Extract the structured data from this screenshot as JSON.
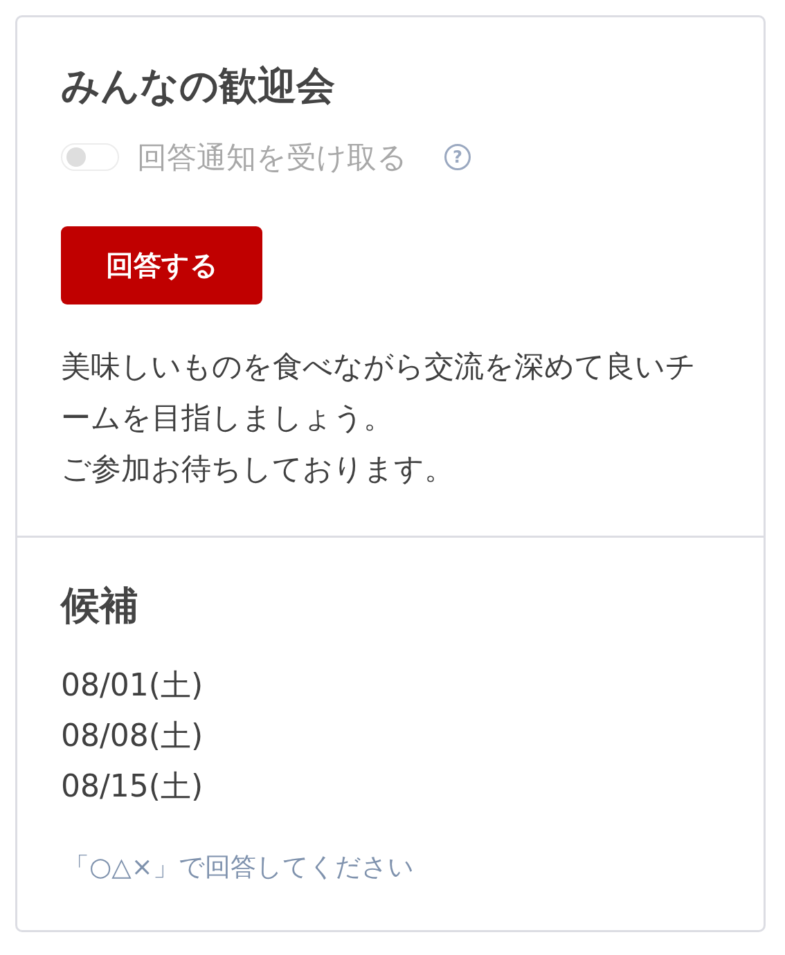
{
  "event": {
    "title": "みんなの歓迎会",
    "notify": {
      "label": "回答通知を受け取る",
      "on": false,
      "help": "?"
    },
    "answer_button": "回答する",
    "description": [
      "美味しいものを食べながら交流を深めて良いチームを目指しましょう。",
      "ご参加お待ちしております。"
    ]
  },
  "candidates": {
    "heading": "候補",
    "dates": [
      "08/01(土)",
      "08/08(土)",
      "08/15(土)"
    ],
    "note": "「○△×」で回答してください"
  }
}
